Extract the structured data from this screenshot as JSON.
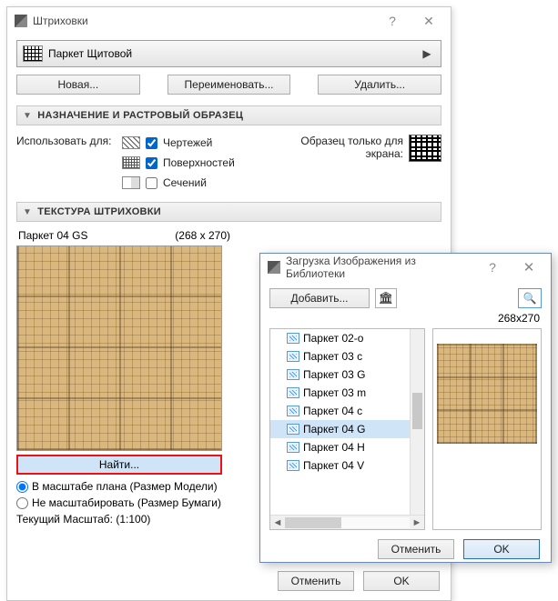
{
  "main": {
    "title": "Штриховки",
    "picker": {
      "name": "Паркет Щитовой"
    },
    "buttons": {
      "new": "Новая...",
      "rename": "Переименовать...",
      "delete": "Удалить..."
    },
    "section1": "НАЗНАЧЕНИЕ И РАСТРОВЫЙ ОБРАЗЕЦ",
    "use_for": "Использовать для:",
    "opt1": "Чертежей",
    "opt2": "Поверхностей",
    "opt3": "Сечений",
    "sample_label": "Образец только для\nэкрана:",
    "section2": "ТЕКСТУРА ШТРИХОВКИ",
    "tex_name": "Паркет 04 GS",
    "tex_dims": "(268 x 270)",
    "find": "Найти...",
    "scale_model": "В масштабе плана (Размер Модели)",
    "scale_paper": "Не масштабировать (Размер Бумаги)",
    "scale_current": "Текущий Масштаб: (1:100)",
    "cancel": "Отменить",
    "ok": "OK"
  },
  "load": {
    "title": "Загрузка Изображения из Библиотеки",
    "add": "Добавить...",
    "dims": "268x270",
    "items": [
      {
        "label": "Паркет 02-о",
        "selected": false
      },
      {
        "label": "Паркет 03 с",
        "selected": false
      },
      {
        "label": "Паркет 03 G",
        "selected": false
      },
      {
        "label": "Паркет 03 m",
        "selected": false
      },
      {
        "label": "Паркет 04 с",
        "selected": false
      },
      {
        "label": "Паркет 04 G",
        "selected": true
      },
      {
        "label": "Паркет 04 H",
        "selected": false
      },
      {
        "label": "Паркет 04 V",
        "selected": false
      }
    ],
    "cancel": "Отменить",
    "ok": "OK"
  }
}
